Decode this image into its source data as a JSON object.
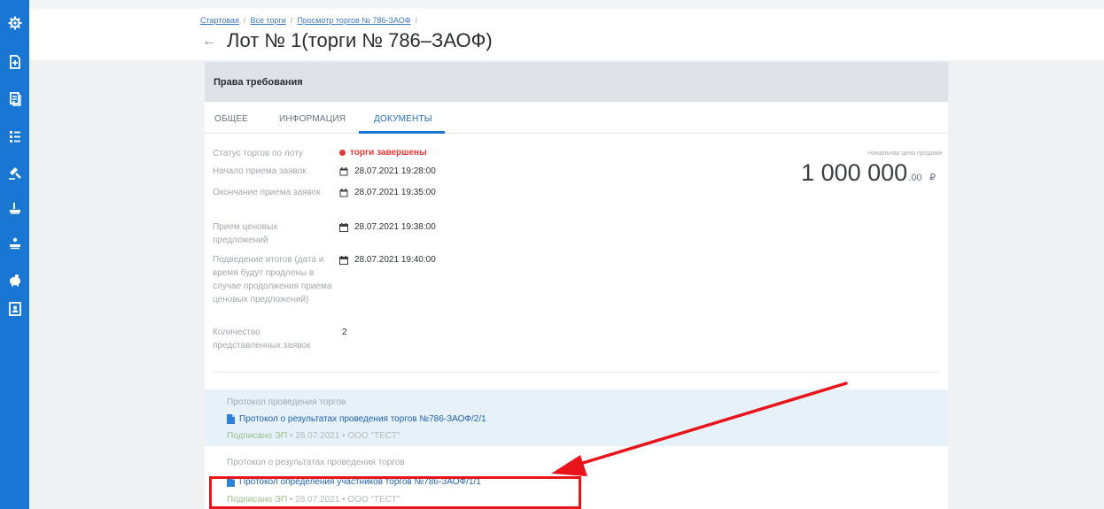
{
  "sidebar": {
    "items": [
      {
        "icon": "settings-gear-icon"
      },
      {
        "icon": "new-document-icon"
      },
      {
        "icon": "documents-stack-icon"
      },
      {
        "icon": "list-tree-icon"
      },
      {
        "icon": "gavel-icon"
      },
      {
        "icon": "hand-pointer-icon"
      },
      {
        "icon": "hand-icon"
      },
      {
        "icon": "piggy-bank-icon"
      },
      {
        "icon": "contacts-book-icon"
      }
    ],
    "color": "#1976d2"
  },
  "breadcrumb": {
    "home": "Стартовая",
    "all": "Все торги",
    "view": "Просмотр торгов № 786-ЗАОФ",
    "separator": "/"
  },
  "title": "Лот № 1(торги № 786–ЗАОФ)",
  "card": {
    "header": "Права требования",
    "tabs": [
      "ОБЩЕЕ",
      "ИНФОРМАЦИЯ",
      "ДОКУМЕНТЫ"
    ],
    "active_tab": "ДОКУМЕНТЫ"
  },
  "info": {
    "status_label": "Статус торгов по лоту",
    "status_value": "торги завершены",
    "start_label": "Начало приема заявок",
    "start_value": "28.07.2021 19:28:00",
    "end_label": "Окончание приема заявок",
    "end_value": "28.07.2021 19:35:00",
    "offers_label": "Прием ценовых предложений",
    "offers_value": "28.07.2021 19:38:00",
    "results_label": "Подведение итогов (дата и время будут продлены в случае продолжения приема ценовых предложений)",
    "results_value": "28.07.2021 19:40:00",
    "count_label": "Количество представленных заявок",
    "count_value": "2"
  },
  "price": {
    "label": "Начальная цена продажи",
    "value": "1 000 000",
    "cents": ".00",
    "currency": "₽"
  },
  "documents": [
    {
      "title": "Протокол проведения торгов",
      "link": "Протокол о результатах проведения торгов №786-ЗАОФ/2/1",
      "signed": "Подписано ЭП",
      "date": "28.07.2021",
      "org": "ООО \"ТЕСТ\"",
      "bullet": "•"
    },
    {
      "title": "Протокол о результатах проведения торгов",
      "link": "Протокол определения участников торгов №786-ЗАОФ/1/1",
      "signed": "Подписано ЭП",
      "date": "28.07.2021",
      "org": "ООО \"ТЕСТ\"",
      "bullet": "•"
    }
  ],
  "colors": {
    "accent": "#1976d2",
    "status": "#e53935",
    "annotation": "#e8141a",
    "highlight": "#e6f1fa"
  }
}
